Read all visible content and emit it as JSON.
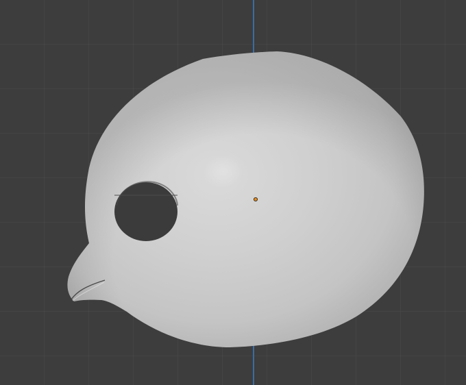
{
  "viewport": {
    "name": "3D Viewport",
    "background_color": "#3d3d3d",
    "grid_color": "#4c4c4c",
    "axis_color": "#3a6fa9",
    "object": {
      "name": "bird-head-mesh",
      "shading": "solid",
      "surface_color": "#cfcfcf",
      "origin_color": "#e08a1e"
    }
  }
}
